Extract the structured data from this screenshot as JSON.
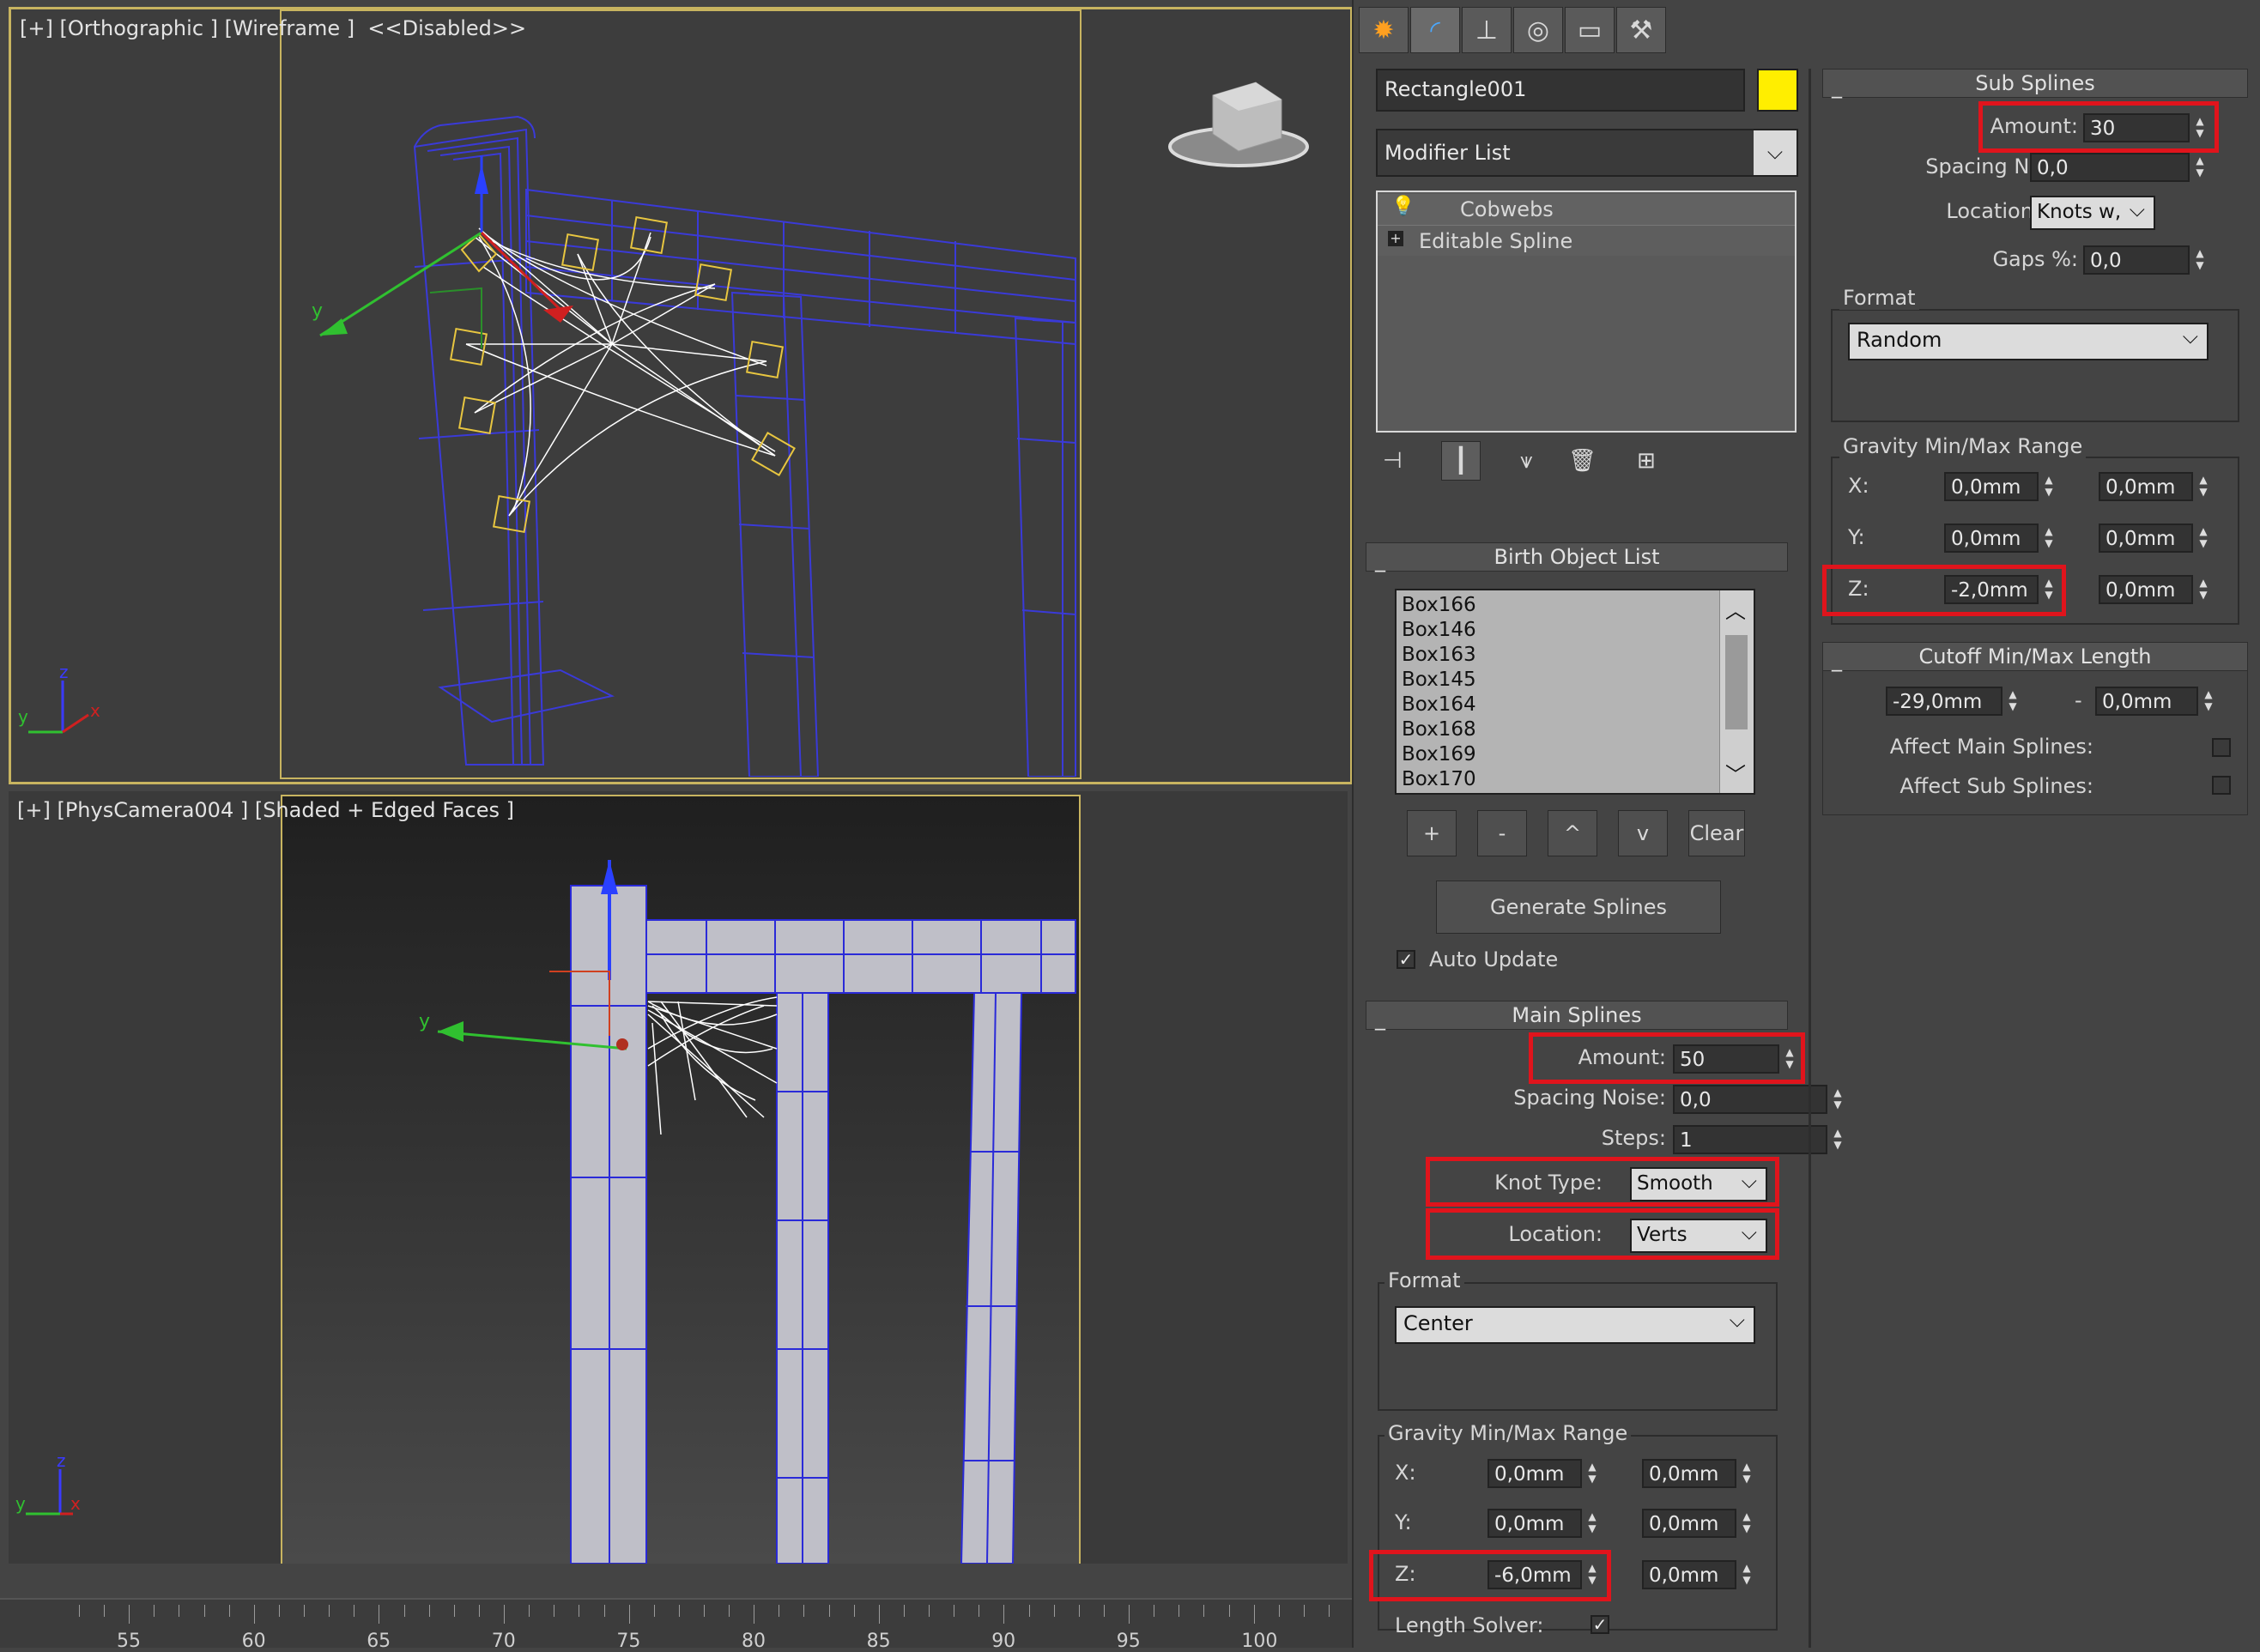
{
  "viewport_top": {
    "label": "[+] [Orthographic ] [Wireframe ]  <<Disabled>>",
    "axis_x": "x",
    "axis_y": "y",
    "axis_z": "z"
  },
  "viewport_bottom": {
    "label": "[+] [PhysCamera004 ] [Shaded + Edged Faces ]",
    "axis_x": "x",
    "axis_y": "y",
    "axis_z": "z"
  },
  "timeline": {
    "labels": [
      "55",
      "60",
      "65",
      "70",
      "75",
      "80",
      "85",
      "90",
      "95",
      "100"
    ]
  },
  "command_panel": {
    "tab_icons": [
      "sun-icon",
      "arc-icon",
      "hierarchy-icon",
      "motion-icon",
      "display-icon",
      "hammer-icon"
    ],
    "object_name": "Rectangle001",
    "object_color": "#ffee00",
    "modifier_list": "Modifier List",
    "stack": [
      "Cobwebs",
      "Editable Spline"
    ],
    "birth_object_list": {
      "title": "Birth Object List",
      "items": [
        "Box166",
        "Box146",
        "Box163",
        "Box145",
        "Box164",
        "Box168",
        "Box169",
        "Box170"
      ],
      "buttons": {
        "add": "+",
        "remove": "-",
        "up": "^",
        "down": "v",
        "clear": "Clear"
      },
      "generate": "Generate Splines",
      "auto_update": "Auto Update"
    },
    "main_splines": {
      "title": "Main Splines",
      "amount_label": "Amount:",
      "amount_value": "50",
      "spacing_noise_label": "Spacing Noise:",
      "spacing_noise_value": "0,0",
      "steps_label": "Steps:",
      "steps_value": "1",
      "knot_type_label": "Knot Type:",
      "knot_type_value": "Smooth",
      "location_label": "Location:",
      "location_value": "Verts",
      "format_title": "Format",
      "format_value": "Center",
      "gravity_title": "Gravity Min/Max Range",
      "x_label": "X:",
      "x_min": "0,0mm",
      "x_max": "0,0mm",
      "y_label": "Y:",
      "y_min": "0,0mm",
      "y_max": "0,0mm",
      "z_label": "Z:",
      "z_min": "-6,0mm",
      "z_max": "0,0mm",
      "length_solver_label": "Length Solver:"
    },
    "sub_splines": {
      "title": "Sub Splines",
      "amount_label": "Amount:",
      "amount_value": "30",
      "spacing_noise_label": "Spacing Noise:",
      "spacing_noise_value": "0,0",
      "location_label": "Location:",
      "location_value": "Knots w,",
      "gaps_label": "Gaps %:",
      "gaps_value": "0,0",
      "format_title": "Format",
      "format_value": "Random",
      "gravity_title": "Gravity Min/Max Range",
      "x_label": "X:",
      "x_min": "0,0mm",
      "x_max": "0,0mm",
      "y_label": "Y:",
      "y_min": "0,0mm",
      "y_max": "0,0mm",
      "z_label": "Z:",
      "z_min": "-2,0mm",
      "z_max": "0,0mm"
    },
    "cutoff": {
      "title": "Cutoff Min/Max Length",
      "min": "-29,0mm",
      "dash": "-",
      "max": "0,0mm",
      "affect_main": "Affect Main Splines:",
      "affect_sub": "Affect Sub Splines:"
    }
  }
}
